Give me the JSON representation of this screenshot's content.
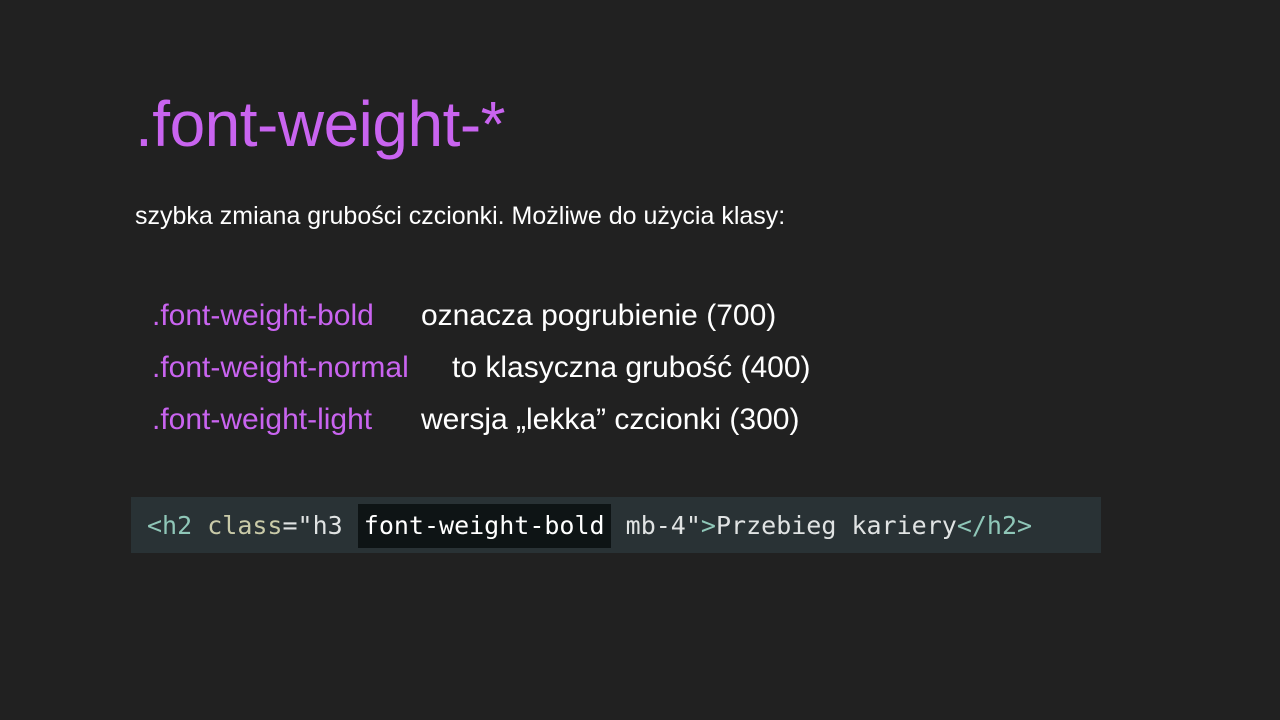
{
  "colors": {
    "background": "#212121",
    "accent": "#c964f0",
    "text": "#ffffff",
    "code_background": "#293235",
    "code_highlight_background": "#0e1415",
    "code_tag": "#8fc7b8",
    "code_attr": "#c9caa8",
    "code_text": "#e0e3e3"
  },
  "slide": {
    "title": ".font-weight-*",
    "subtitle": "szybka zmiana grubości czcionki. Możliwe do użycia klasy:",
    "classes": [
      {
        "name": ".font-weight-bold",
        "description": "oznacza pogrubienie (700)"
      },
      {
        "name": ".font-weight-normal",
        "description": "to klasyczna grubość (400)"
      },
      {
        "name": ".font-weight-light",
        "description": "wersja „lekka” czcionki (300)"
      }
    ],
    "code": {
      "open_tag": "<h2",
      "attr_name": "class",
      "attr_eq_open": "=\"h3",
      "highlight": "font-weight-bold",
      "attr_rest": "mb-4\"",
      "tag_close": ">",
      "content": "Przebieg kariery",
      "close_tag": "</h2>"
    }
  }
}
